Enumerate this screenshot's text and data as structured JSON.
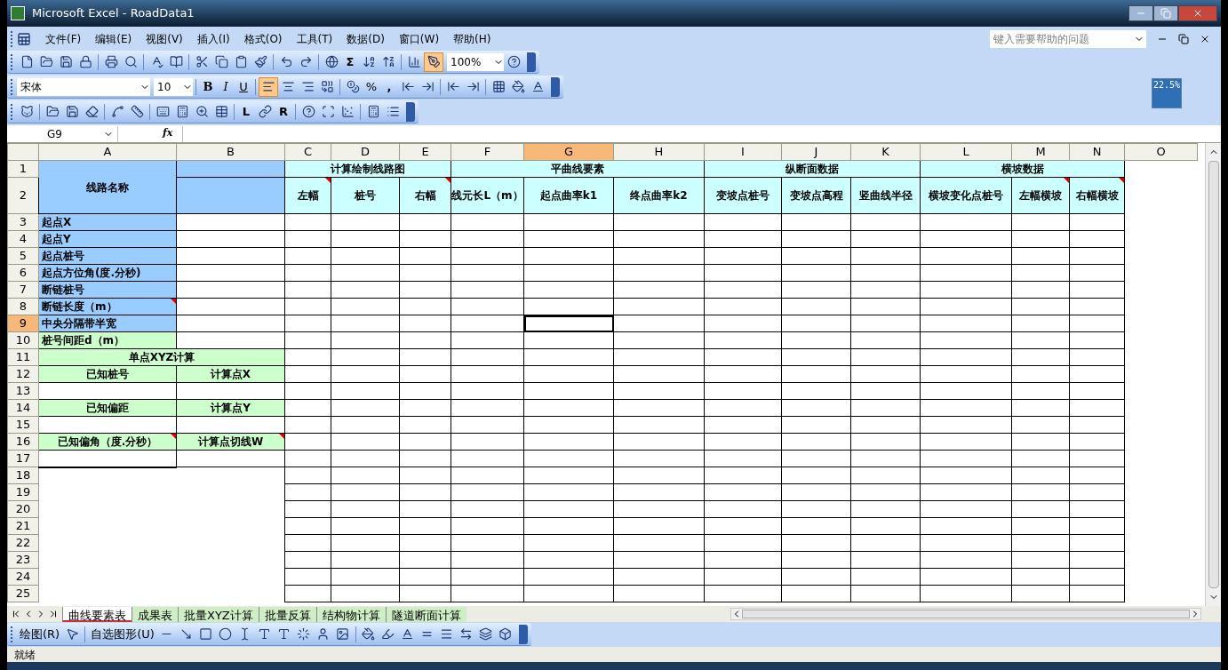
{
  "window": {
    "title": "Microsoft Excel - RoadData1"
  },
  "menu": [
    "文件(F)",
    "编辑(E)",
    "视图(V)",
    "插入(I)",
    "格式(O)",
    "工具(T)",
    "数据(D)",
    "窗口(W)",
    "帮助(H)"
  ],
  "help_search": {
    "placeholder": "键入需要帮助的问题"
  },
  "standard_toolbar": {
    "autosum": "Σ",
    "zoom": "100%"
  },
  "formatting_toolbar": {
    "font": "宋体",
    "size": "10",
    "bold": "B",
    "italic": "I",
    "underline": "U",
    "percent": "%",
    "comma": ","
  },
  "custom_toolbar": {
    "l_button": "L",
    "r_button": "R"
  },
  "progress_widget": "22.5%",
  "formula_bar": {
    "name_box": "G9",
    "fx": "fx"
  },
  "columns": [
    {
      "label": "A",
      "selected": false
    },
    {
      "label": "B",
      "selected": false
    },
    {
      "label": "C",
      "selected": false
    },
    {
      "label": "D",
      "selected": false
    },
    {
      "label": "E",
      "selected": false
    },
    {
      "label": "F",
      "selected": false
    },
    {
      "label": "G",
      "selected": true
    },
    {
      "label": "H",
      "selected": false
    },
    {
      "label": "I",
      "selected": false
    },
    {
      "label": "J",
      "selected": false
    },
    {
      "label": "K",
      "selected": false
    },
    {
      "label": "L",
      "selected": false
    },
    {
      "label": "M",
      "selected": false
    },
    {
      "label": "N",
      "selected": false
    },
    {
      "label": "O",
      "selected": false
    }
  ],
  "rows": [
    {
      "label": "1",
      "selected": false
    },
    {
      "label": "2",
      "selected": false
    },
    {
      "label": "3",
      "selected": false
    },
    {
      "label": "4",
      "selected": false
    },
    {
      "label": "5",
      "selected": false
    },
    {
      "label": "6",
      "selected": false
    },
    {
      "label": "7",
      "selected": false
    },
    {
      "label": "8",
      "selected": false
    },
    {
      "label": "9",
      "selected": true
    },
    {
      "label": "10",
      "selected": false
    },
    {
      "label": "11",
      "selected": false
    },
    {
      "label": "12",
      "selected": false
    },
    {
      "label": "13",
      "selected": false
    },
    {
      "label": "14",
      "selected": false
    },
    {
      "label": "15",
      "selected": false
    },
    {
      "label": "16",
      "selected": false
    },
    {
      "label": "17",
      "selected": false
    },
    {
      "label": "18",
      "selected": false
    },
    {
      "label": "19",
      "selected": false
    },
    {
      "label": "20",
      "selected": false
    },
    {
      "label": "21",
      "selected": false
    },
    {
      "label": "22",
      "selected": false
    },
    {
      "label": "23",
      "selected": false
    },
    {
      "label": "24",
      "selected": false
    },
    {
      "label": "25",
      "selected": false
    }
  ],
  "route_params": {
    "title": "线路名称",
    "items": [
      {
        "label": "起点X",
        "kind": "param",
        "comment": false
      },
      {
        "label": "起点Y",
        "kind": "param",
        "comment": false
      },
      {
        "label": "起点桩号",
        "kind": "param",
        "comment": false
      },
      {
        "label": "起点方位角(度.分秒)",
        "kind": "param",
        "comment": false
      },
      {
        "label": "断链桩号",
        "kind": "param",
        "comment": false
      },
      {
        "label": "断链长度（m）",
        "kind": "param",
        "comment": true
      },
      {
        "label": "中央分隔带半宽",
        "kind": "param",
        "comment": false
      },
      {
        "label": "桩号间距d（m）",
        "kind": "setting",
        "comment": false
      }
    ]
  },
  "header_groups": [
    {
      "label": "计算绘制线路图",
      "columns": [
        {
          "label": "左幅",
          "comment": true
        },
        {
          "label": "桩号",
          "comment": false
        },
        {
          "label": "右幅",
          "comment": true
        }
      ]
    },
    {
      "label": "平曲线要素",
      "columns": [
        {
          "label": "线元长L（m）",
          "comment": false
        },
        {
          "label": "起点曲率k1",
          "comment": false
        },
        {
          "label": "终点曲率k2",
          "comment": false
        }
      ]
    },
    {
      "label": "纵断面数据",
      "columns": [
        {
          "label": "变坡点桩号",
          "comment": false
        },
        {
          "label": "变坡点高程",
          "comment": false
        },
        {
          "label": "竖曲线半径",
          "comment": false
        }
      ]
    },
    {
      "label": "横坡数据",
      "columns": [
        {
          "label": "横坡变化点桩号",
          "comment": false
        },
        {
          "label": "左幅横坡",
          "comment": true
        },
        {
          "label": "右幅横坡",
          "comment": true
        }
      ]
    }
  ],
  "single_point": {
    "title": "单点XYZ计算",
    "pairs": [
      {
        "left": {
          "label": "已知桩号",
          "comment": false
        },
        "right": {
          "label": "计算点X",
          "comment": false
        }
      },
      {
        "left": {
          "label": "已知偏距",
          "comment": false
        },
        "right": {
          "label": "计算点Y",
          "comment": false
        }
      },
      {
        "left": {
          "label": "已知偏角（度.分秒）",
          "comment": true
        },
        "right": {
          "label": "计算点切线W",
          "comment": true
        }
      }
    ]
  },
  "sheet_tabs": [
    {
      "label": "曲线要素表",
      "selected": true
    },
    {
      "label": "成果表",
      "selected": false
    },
    {
      "label": "批量XYZ计算",
      "selected": false
    },
    {
      "label": "批量反算",
      "selected": false
    },
    {
      "label": "结构物计算",
      "selected": false
    },
    {
      "label": "隧道断面计算",
      "selected": false
    }
  ],
  "drawing_toolbar": {
    "draw": "绘图(R)",
    "autoshapes": "自选图形(U)"
  },
  "status": "就绪"
}
